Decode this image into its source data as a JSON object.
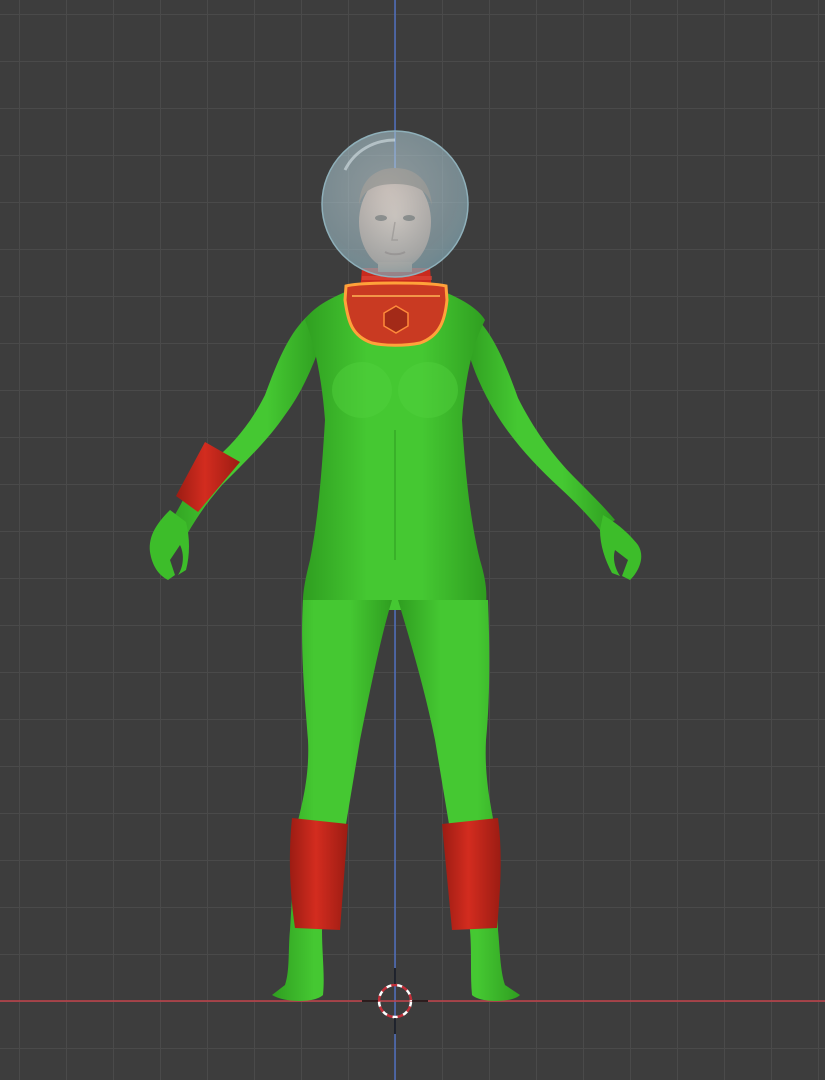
{
  "viewport": {
    "background_color": "#3d3d3d",
    "grid_color": "#4a4a4a",
    "x_axis_color": "#c2434b",
    "z_axis_color": "#4f6fbf"
  },
  "scene": {
    "figure": {
      "suit_color": "#3dbd2a",
      "suit_shadow_color": "#2e9a1f",
      "cuff_color": "#c92a1e",
      "cuff_shadow_color": "#9c1c13",
      "helmet_color": "#b7d2da",
      "skin_color": "#c89d86",
      "hair_color": "#6b5040"
    },
    "selection_outline_color": "#ffa23a",
    "cursor_icon": "3d-cursor-icon"
  }
}
